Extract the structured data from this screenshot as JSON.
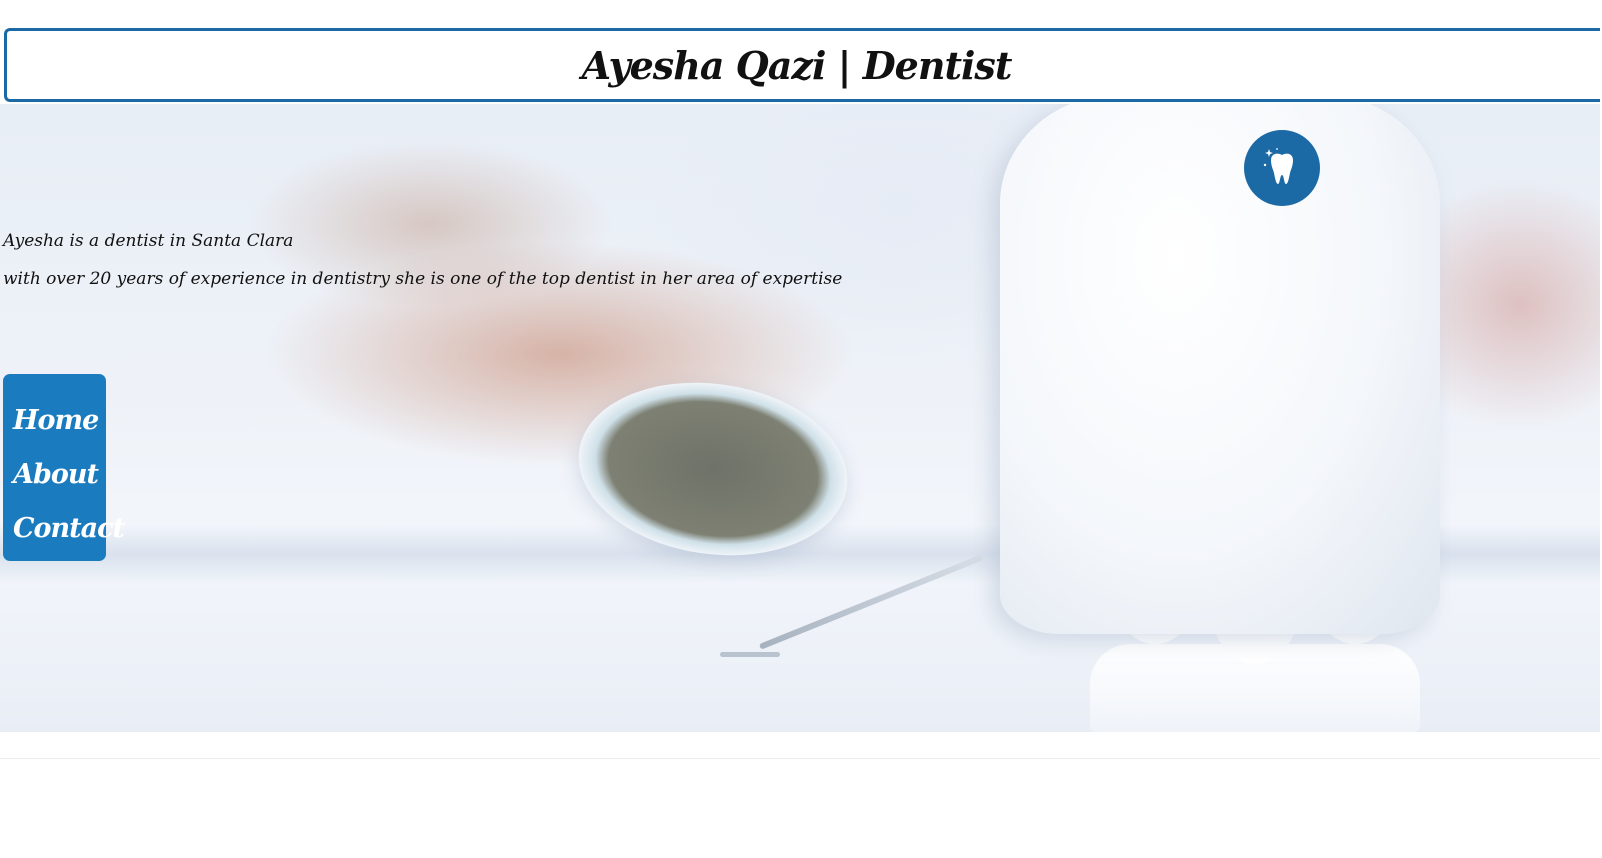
{
  "header": {
    "title": "Ayesha Qazi | Dentist"
  },
  "logo": {
    "icon": "tooth-icon",
    "color": "#1b6aa5"
  },
  "intro": {
    "line1": "Ayesha is a dentist in Santa Clara",
    "line2": "with over 20 years of experience in dentistry she is one of the top dentist in her area of expertise"
  },
  "nav": {
    "color": "#1a7bbf",
    "items": [
      {
        "label": "Home"
      },
      {
        "label": "About"
      },
      {
        "label": "Contact"
      }
    ]
  },
  "colors": {
    "accent": "#1b6aa5",
    "text": "#111111",
    "nav_text": "#ffffff"
  }
}
